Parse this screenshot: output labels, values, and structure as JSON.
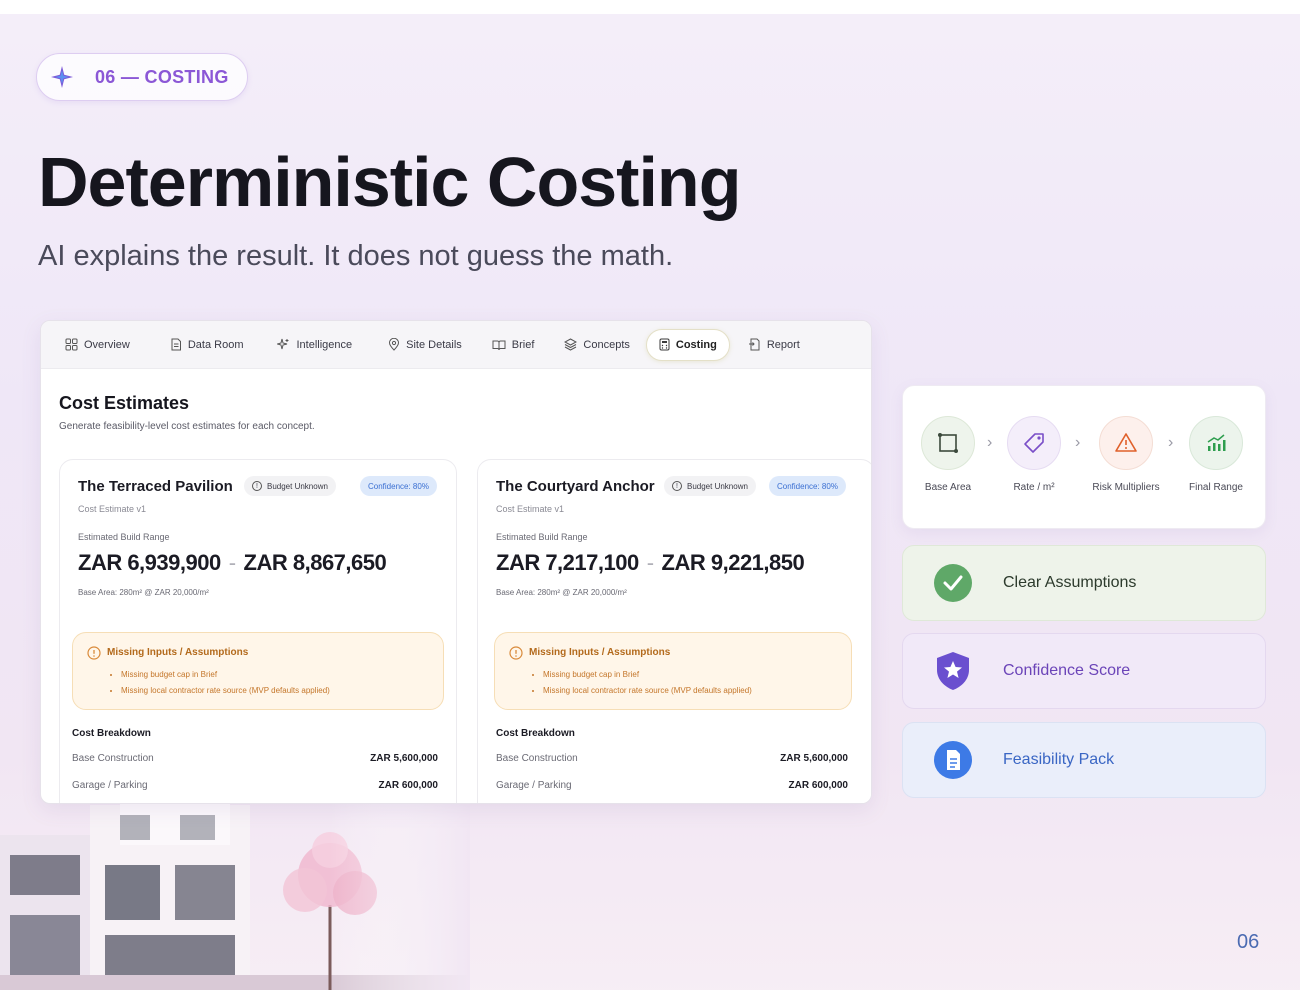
{
  "section": {
    "label": "06 — COSTING"
  },
  "title": "Deterministic Costing",
  "subtitle": "AI explains the result. It does not guess the math.",
  "app": {
    "tabs": [
      {
        "label": "Overview",
        "icon": "grid-icon"
      },
      {
        "label": "Data Room",
        "icon": "document-icon"
      },
      {
        "label": "Intelligence",
        "icon": "sparkle-icon"
      },
      {
        "label": "Site Details",
        "icon": "pin-icon"
      },
      {
        "label": "Brief",
        "icon": "book-icon"
      },
      {
        "label": "Concepts",
        "icon": "layers-icon"
      },
      {
        "label": "Costing",
        "icon": "calculator-icon",
        "active": true
      },
      {
        "label": "Report",
        "icon": "report-icon"
      }
    ],
    "heading": "Cost Estimates",
    "description": "Generate feasibility-level cost estimates for each concept.",
    "concepts": [
      {
        "name": "The Terraced Pavilion",
        "budget_badge": "Budget Unknown",
        "confidence_badge": "Confidence: 80%",
        "version": "Cost Estimate v1",
        "range_label": "Estimated Build Range",
        "range_low": "ZAR 6,939,900",
        "range_sep": "-",
        "range_high": "ZAR 8,867,650",
        "base_area": "Base Area: 280m² @ ZAR 20,000/m²",
        "warning": {
          "title": "Missing Inputs / Assumptions",
          "items": [
            "Missing budget cap in Brief",
            "Missing local contractor rate source (MVP defaults applied)"
          ]
        },
        "breakdown_title": "Cost Breakdown",
        "breakdown": [
          {
            "label": "Base Construction",
            "value": "ZAR 5,600,000"
          },
          {
            "label": "Garage / Parking",
            "value": "ZAR 600,000"
          }
        ]
      },
      {
        "name": "The Courtyard Anchor",
        "budget_badge": "Budget Unknown",
        "confidence_badge": "Confidence: 80%",
        "version": "Cost Estimate v1",
        "range_label": "Estimated Build Range",
        "range_low": "ZAR 7,217,100",
        "range_sep": "-",
        "range_high": "ZAR 9,221,850",
        "base_area": "Base Area: 280m² @ ZAR 20,000/m²",
        "warning": {
          "title": "Missing Inputs / Assumptions",
          "items": [
            "Missing budget cap in Brief",
            "Missing local contractor rate source (MVP defaults applied)"
          ]
        },
        "breakdown_title": "Cost Breakdown",
        "breakdown": [
          {
            "label": "Base Construction",
            "value": "ZAR 5,600,000"
          },
          {
            "label": "Garage / Parking",
            "value": "ZAR 600,000"
          }
        ]
      }
    ]
  },
  "flow": [
    {
      "label": "Base Area",
      "icon": "crop-icon"
    },
    {
      "label": "Rate / m²",
      "icon": "tag-icon"
    },
    {
      "label": "Risk Multipliers",
      "icon": "warning-icon"
    },
    {
      "label": "Final Range",
      "icon": "chart-icon"
    }
  ],
  "features": [
    {
      "label": "Clear Assumptions",
      "icon": "check-icon"
    },
    {
      "label": "Confidence Score",
      "icon": "shield-star-icon"
    },
    {
      "label": "Feasibility Pack",
      "icon": "document-icon"
    }
  ],
  "colors": {
    "accent": "#8b57d6",
    "green": "#2e9e4e",
    "blue": "#3a66c4",
    "orange": "#e0602a"
  },
  "page_number": "06"
}
